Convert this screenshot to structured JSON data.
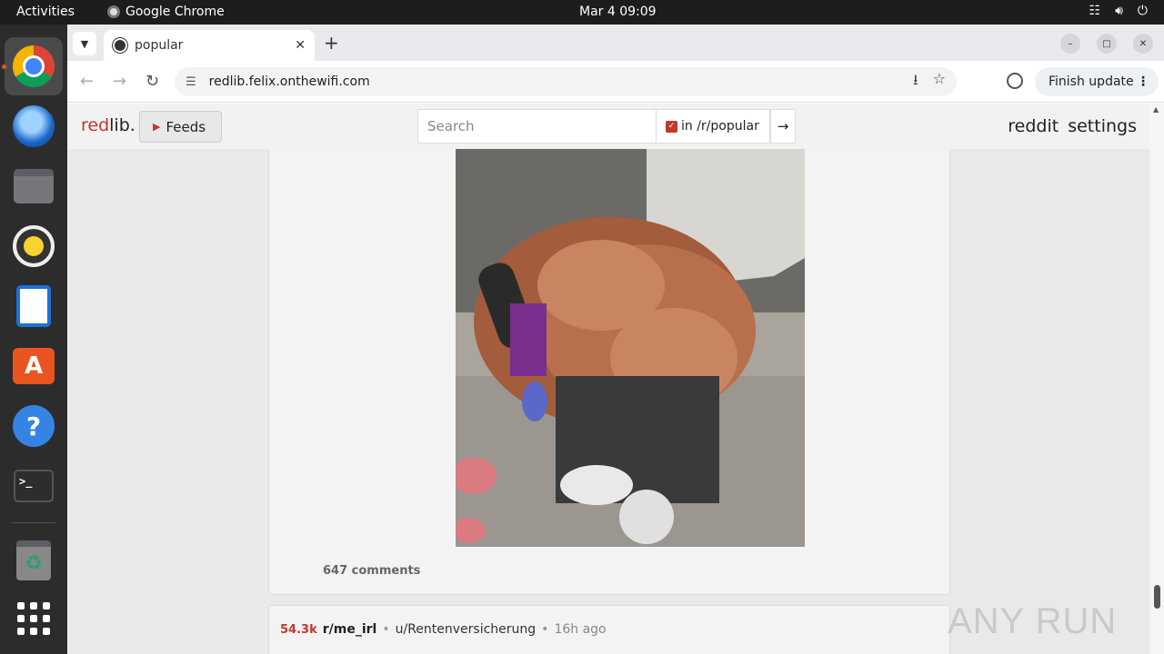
{
  "os": {
    "activities": "Activities",
    "app_name": "Google Chrome",
    "clock": "Mar 4  09:09"
  },
  "dock": {
    "items": [
      "chrome-icon",
      "thunderbird-icon",
      "files-icon",
      "rhythmbox-icon",
      "writer-icon",
      "app-center-icon",
      "help-icon",
      "terminal-icon",
      "trash-icon",
      "show-apps-icon"
    ]
  },
  "browser": {
    "tab_title": "popular",
    "url": "redlib.felix.onthewifi.com",
    "finish_update": "Finish update"
  },
  "page": {
    "logo_red": "red",
    "logo_rest": "lib.",
    "feeds_label": "Feeds",
    "search_placeholder": "Search",
    "restrict_label": "in /r/popular",
    "restrict_checked": true,
    "nav_reddit": "reddit",
    "nav_settings": "settings",
    "post": {
      "comments": "647 comments"
    },
    "next_post": {
      "score": "54.3k",
      "subreddit": "r/me_irl",
      "author": "u/Rentenversicherung",
      "time": "16h ago"
    }
  },
  "watermark": "ANY RUN",
  "colors": {
    "accent_red": "#c0392b",
    "page_bg": "#e9e9e9",
    "ubuntu_orange": "#e95420"
  }
}
